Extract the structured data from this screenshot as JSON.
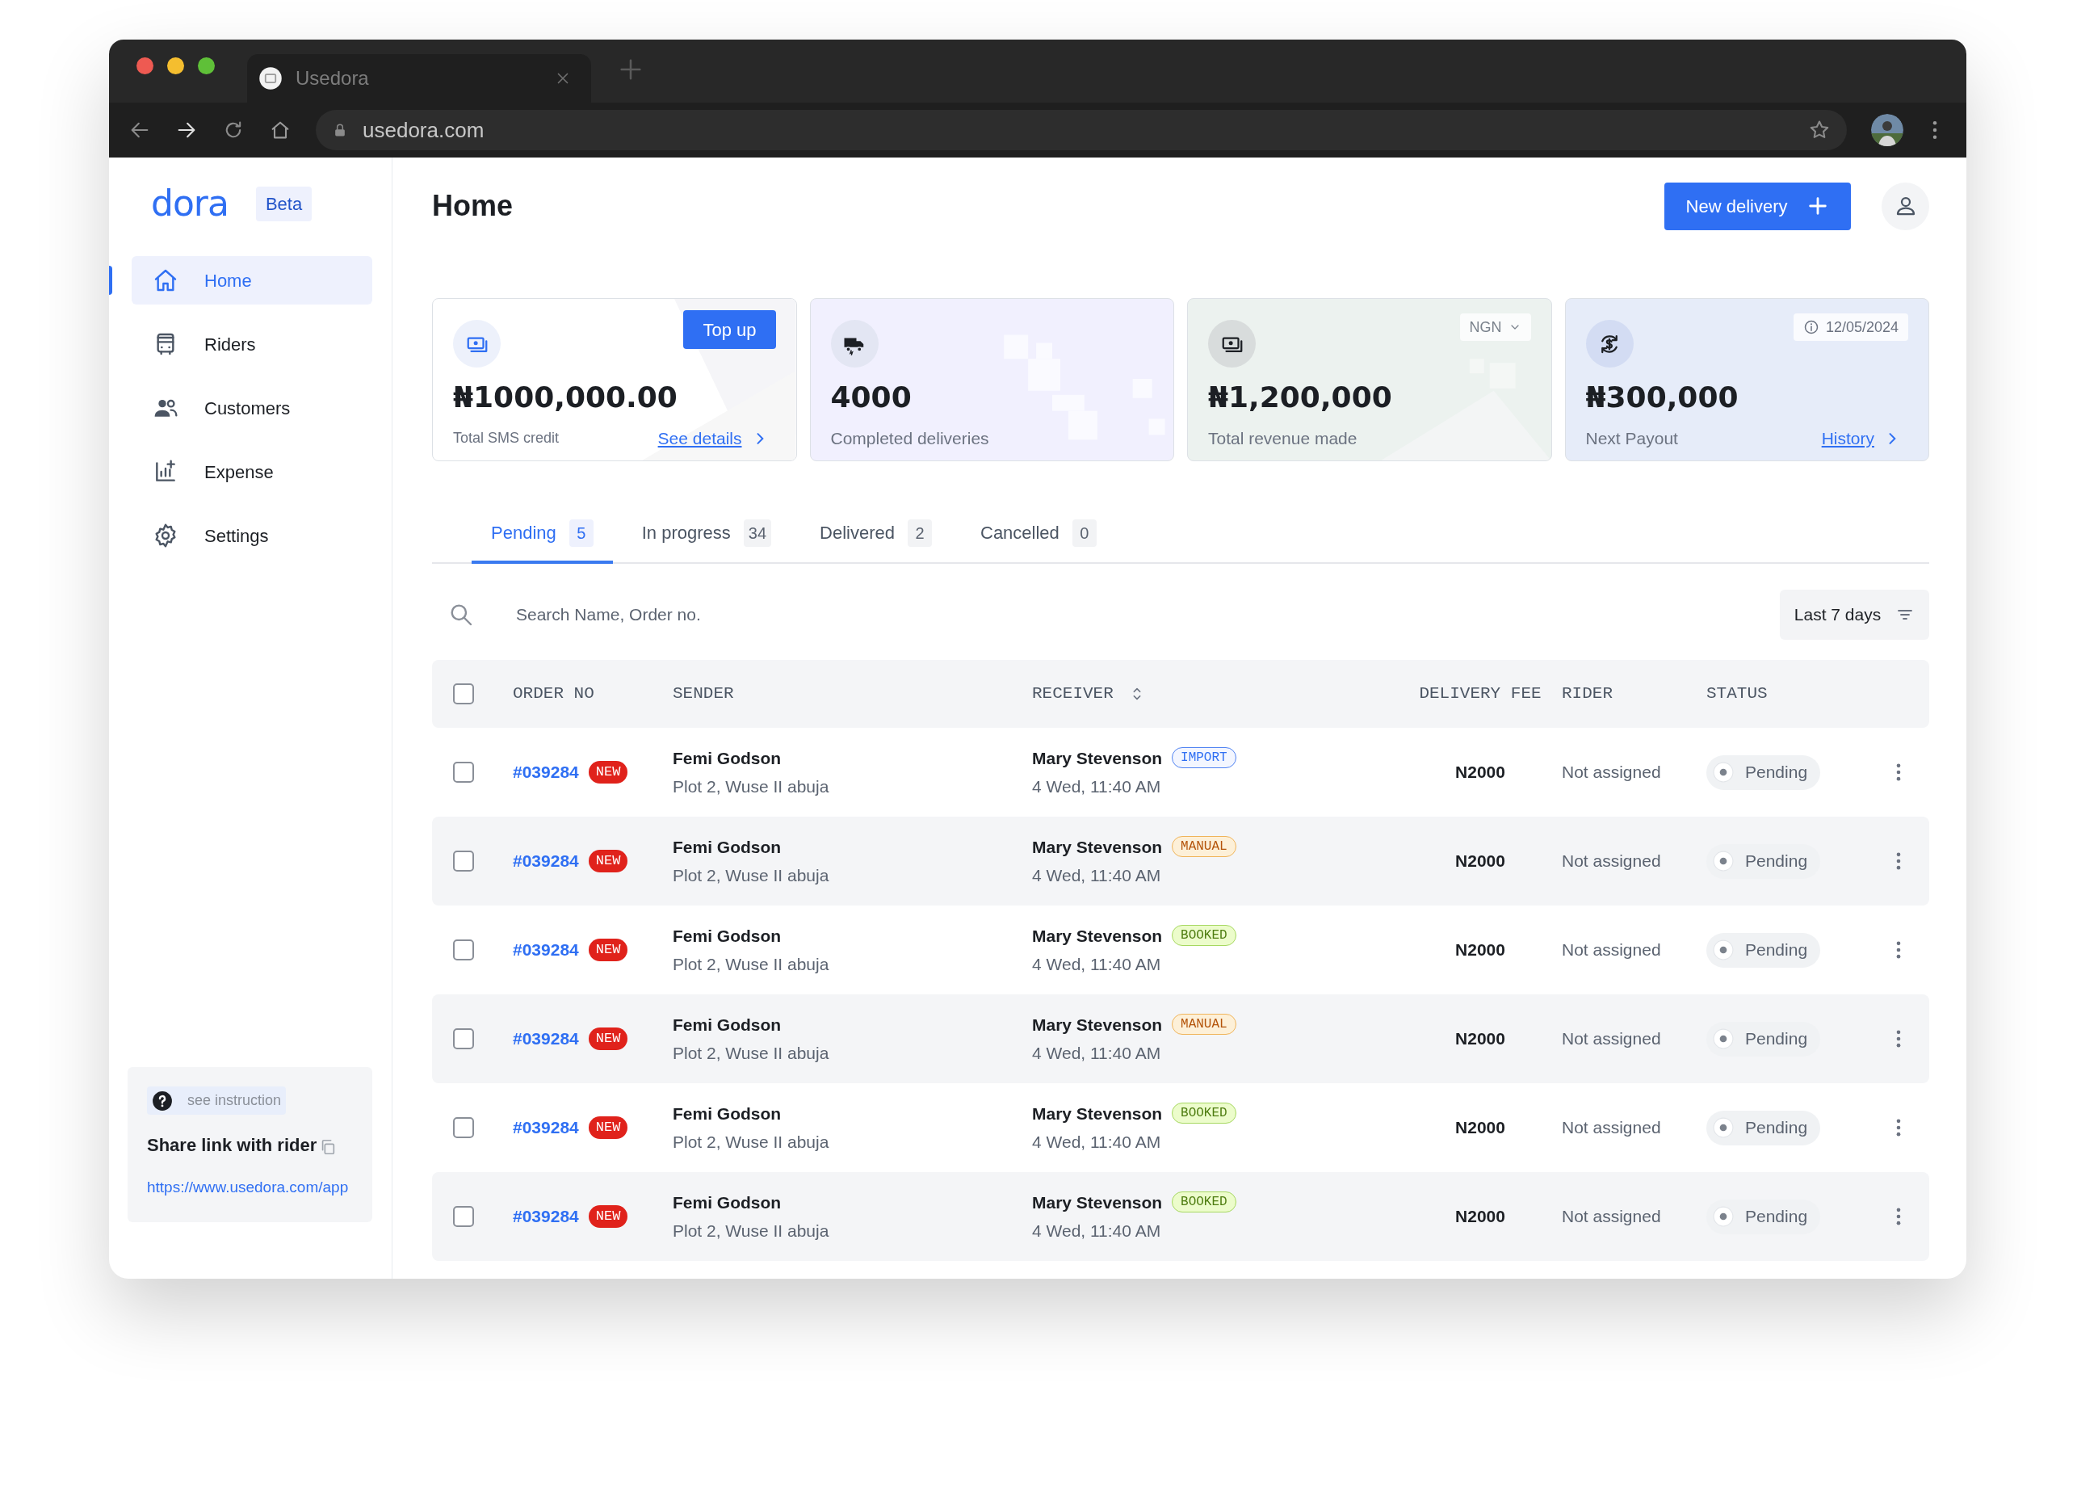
{
  "browser": {
    "tab_title": "Usedora",
    "url": "usedora.com"
  },
  "sidebar": {
    "logo": "dora",
    "badge": "Beta",
    "items": [
      {
        "label": "Home",
        "selected": true
      },
      {
        "label": "Riders",
        "selected": false
      },
      {
        "label": "Customers",
        "selected": false
      },
      {
        "label": "Expense",
        "selected": false
      },
      {
        "label": "Settings",
        "selected": false
      }
    ],
    "help": {
      "link": "see instruction",
      "title": "Share link with rider",
      "url": "https://www.usedora.com/app"
    }
  },
  "header": {
    "title": "Home",
    "button": "New delivery"
  },
  "cards": [
    {
      "kind": "sms",
      "value": "₦1000,000.00",
      "label": "Total SMS credit",
      "action": "Top up",
      "link": "See details"
    },
    {
      "kind": "deliveries",
      "value": "4000",
      "label": "Completed deliveries"
    },
    {
      "kind": "revenue",
      "value": "₦1,200,000",
      "label": "Total revenue made",
      "currency": "NGN"
    },
    {
      "kind": "payout",
      "value": "₦300,000",
      "label": "Next Payout",
      "date": "12/05/2024",
      "link": "History"
    }
  ],
  "tabs": [
    {
      "label": "Pending",
      "count": "5",
      "selected": true
    },
    {
      "label": "In progress",
      "count": "34",
      "selected": false
    },
    {
      "label": "Delivered",
      "count": "2",
      "selected": false
    },
    {
      "label": "Cancelled",
      "count": "0",
      "selected": false
    }
  ],
  "search": {
    "placeholder": "Search Name, Order no."
  },
  "filter": "Last 7 days",
  "table": {
    "select_all_checked": false,
    "columns": [
      "ORDER NO",
      "SENDER",
      "RECEIVER",
      "DELIVERY FEE",
      "RIDER",
      "STATUS"
    ],
    "rows": [
      {
        "checked": false,
        "order": "#039284",
        "badge": "NEW",
        "sender": "Femi Godson",
        "address": "Plot 2, Wuse II abuja",
        "receiver": "Mary Stevenson",
        "tag": {
          "label": "IMPORT",
          "kind": "import"
        },
        "time": "4 Wed, 11:40 AM",
        "fee": "N2000",
        "rider": "Not assigned",
        "status": "Pending"
      },
      {
        "checked": false,
        "order": "#039284",
        "badge": "NEW",
        "sender": "Femi Godson",
        "address": "Plot 2, Wuse II abuja",
        "receiver": "Mary Stevenson",
        "tag": {
          "label": "MANUAL",
          "kind": "manual"
        },
        "time": "4 Wed, 11:40 AM",
        "fee": "N2000",
        "rider": "Not assigned",
        "status": "Pending"
      },
      {
        "checked": false,
        "order": "#039284",
        "badge": "NEW",
        "sender": "Femi Godson",
        "address": "Plot 2, Wuse II abuja",
        "receiver": "Mary Stevenson",
        "tag": {
          "label": "BOOKED",
          "kind": "booked"
        },
        "time": "4 Wed, 11:40 AM",
        "fee": "N2000",
        "rider": "Not assigned",
        "status": "Pending"
      },
      {
        "checked": false,
        "order": "#039284",
        "badge": "NEW",
        "sender": "Femi Godson",
        "address": "Plot 2, Wuse II abuja",
        "receiver": "Mary Stevenson",
        "tag": {
          "label": "MANUAL",
          "kind": "manual"
        },
        "time": "4 Wed, 11:40 AM",
        "fee": "N2000",
        "rider": "Not assigned",
        "status": "Pending"
      },
      {
        "checked": false,
        "order": "#039284",
        "badge": "NEW",
        "sender": "Femi Godson",
        "address": "Plot 2, Wuse II abuja",
        "receiver": "Mary Stevenson",
        "tag": {
          "label": "BOOKED",
          "kind": "booked"
        },
        "time": "4 Wed, 11:40 AM",
        "fee": "N2000",
        "rider": "Not assigned",
        "status": "Pending"
      },
      {
        "checked": false,
        "order": "#039284",
        "badge": "NEW",
        "sender": "Femi Godson",
        "address": "Plot 2, Wuse II abuja",
        "receiver": "Mary Stevenson",
        "tag": {
          "label": "BOOKED",
          "kind": "booked"
        },
        "time": "4 Wed, 11:40 AM",
        "fee": "N2000",
        "rider": "Not assigned",
        "status": "Pending"
      }
    ]
  }
}
